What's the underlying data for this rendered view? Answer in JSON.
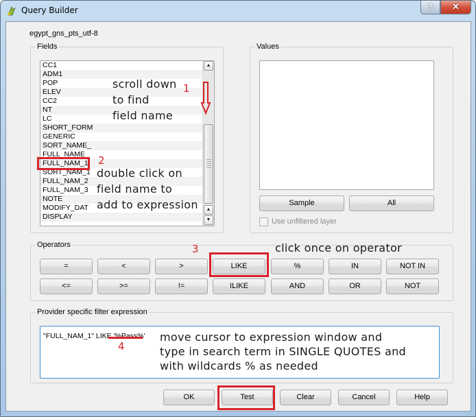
{
  "window": {
    "title": "Query Builder",
    "app_icon": "qgis-icon",
    "help_button": "?",
    "close_button": "✕"
  },
  "layer_name": "egypt_gns_pts_utf-8",
  "fields": {
    "title": "Fields",
    "items": [
      "CC1",
      "ADM1",
      "POP",
      "ELEV",
      "CC2",
      "NT",
      "LC",
      "SHORT_FORM",
      "GENERIC",
      "SORT_NAME_",
      "FULL_NAME_",
      "FULL_NAM_1",
      "SORT_NAM_1",
      "FULL_NAM_2",
      "FULL_NAM_3",
      "NOTE",
      "MODIFY_DAT",
      "DISPLAY"
    ],
    "highlighted": "FULL_NAM_1",
    "scroll_up": "▲",
    "scroll_down": "▼"
  },
  "values": {
    "title": "Values",
    "sample_label": "Sample",
    "all_label": "All",
    "unfiltered_label": "Use unfiltered layer",
    "unfiltered_checked": false
  },
  "operators": {
    "title": "Operators",
    "row1": [
      "=",
      "<",
      ">",
      "LIKE",
      "%",
      "IN",
      "NOT IN"
    ],
    "row2": [
      "<=",
      ">=",
      "!=",
      "ILIKE",
      "AND",
      "OR",
      "NOT"
    ]
  },
  "expression": {
    "title": "Provider specific filter expression",
    "value": "\"FULL_NAM_1\" LIKE '%Pass%'"
  },
  "footer": {
    "ok": "OK",
    "test": "Test",
    "clear": "Clear",
    "cancel": "Cancel",
    "help": "Help"
  },
  "annotations": {
    "step1_num": "1",
    "step1_lines": [
      "scroll down",
      "to find",
      "field name"
    ],
    "step2_num": "2",
    "step2_lines": [
      "double click on",
      "field name to",
      "add to expression"
    ],
    "step3_num": "3",
    "step3_text": "click once on operator",
    "step4_num": "4",
    "step4_lines": [
      "move cursor to expression window and",
      "type in search term in SINGLE QUOTES and",
      "with wildcards % as needed"
    ],
    "accent_color": "#d8232a"
  }
}
